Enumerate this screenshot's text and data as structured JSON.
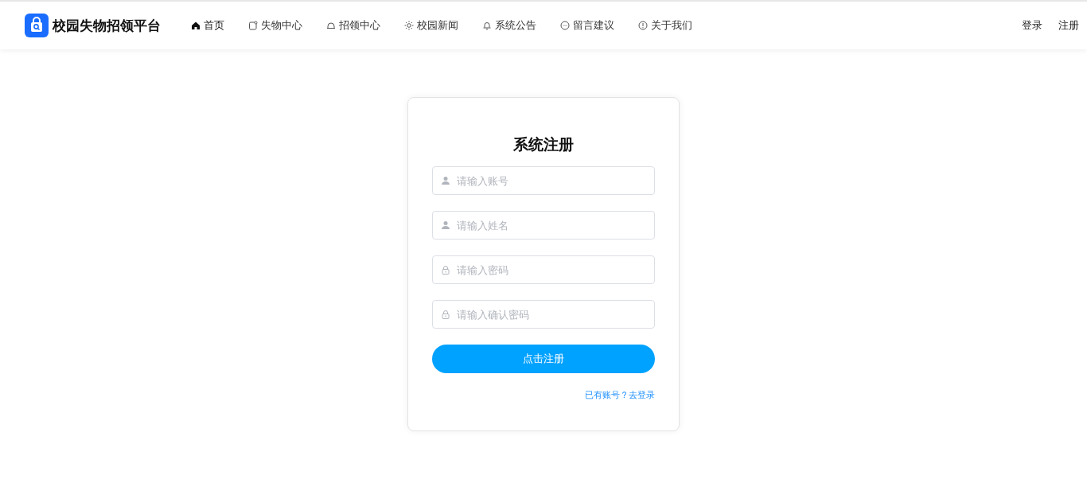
{
  "header": {
    "brand": "校园失物招领平台",
    "nav": [
      {
        "label": "首页",
        "kind": "home",
        "selected": true
      },
      {
        "label": "失物中心",
        "kind": "tag",
        "selected": false
      },
      {
        "label": "招领中心",
        "kind": "helmet",
        "selected": false
      },
      {
        "label": "校园新闻",
        "kind": "sun",
        "selected": false
      },
      {
        "label": "系统公告",
        "kind": "bell",
        "selected": false
      },
      {
        "label": "留言建议",
        "kind": "chat",
        "selected": false
      },
      {
        "label": "关于我们",
        "kind": "info",
        "selected": false
      }
    ],
    "actions": [
      "登录",
      "注册"
    ]
  },
  "form": {
    "title": "系统注册",
    "fields": [
      {
        "placeholder": "请输入账号",
        "kind": "user"
      },
      {
        "placeholder": "请输入姓名",
        "kind": "user"
      },
      {
        "placeholder": "请输入密码",
        "kind": "lock"
      },
      {
        "placeholder": "请输入确认密码",
        "kind": "lock"
      }
    ],
    "submit": "点击注册",
    "login_link": "已有账号？去登录"
  }
}
